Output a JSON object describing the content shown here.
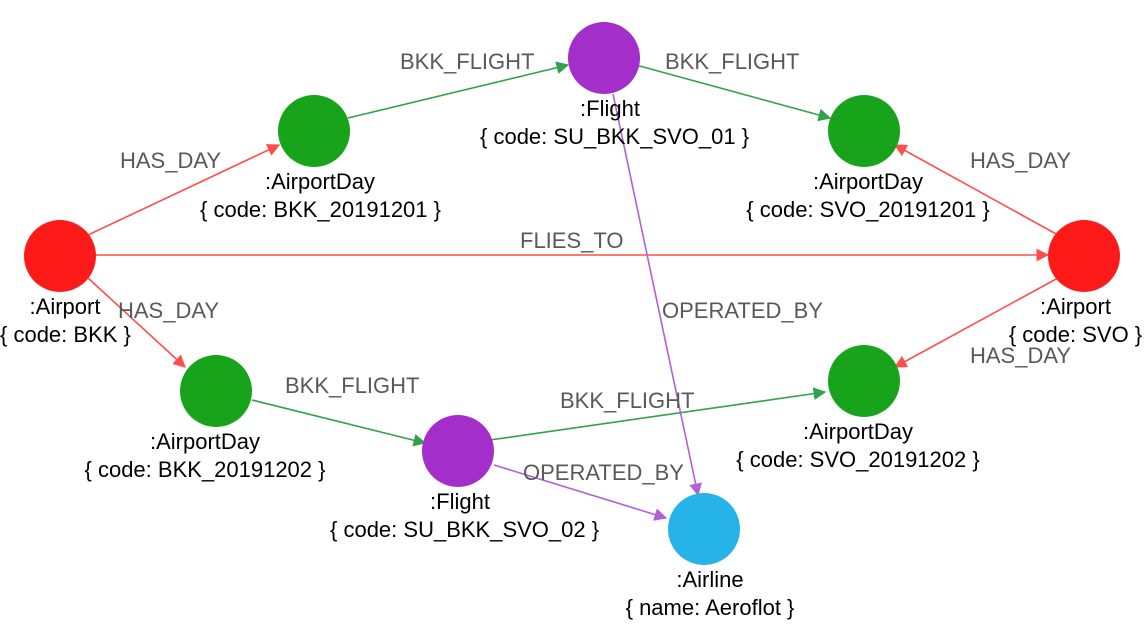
{
  "nodes": {
    "airport_bkk": {
      "type": ":Airport",
      "props": "{ code: BKK }"
    },
    "airport_svo": {
      "type": ":Airport",
      "props": "{ code: SVO }"
    },
    "airportday_bkk_1": {
      "type": ":AirportDay",
      "props": "{ code: BKK_20191201 }"
    },
    "airportday_bkk_2": {
      "type": ":AirportDay",
      "props": "{ code: BKK_20191202 }"
    },
    "airportday_svo_1": {
      "type": ":AirportDay",
      "props": "{ code: SVO_20191201 }"
    },
    "airportday_svo_2": {
      "type": ":AirportDay",
      "props": "{ code: SVO_20191202 }"
    },
    "flight_1": {
      "type": ":Flight",
      "props": "{ code: SU_BKK_SVO_01 }"
    },
    "flight_2": {
      "type": ":Flight",
      "props": "{ code: SU_BKK_SVO_02 }"
    },
    "airline": {
      "type": ":Airline",
      "props": "{ name: Aeroflot }"
    }
  },
  "edges": {
    "has_day_1": "HAS_DAY",
    "has_day_2": "HAS_DAY",
    "has_day_3": "HAS_DAY",
    "has_day_4": "HAS_DAY",
    "flies_to": "FLIES_TO",
    "bkk_flight_1": "BKK_FLIGHT",
    "bkk_flight_2": "BKK_FLIGHT",
    "bkk_flight_3": "BKK_FLIGHT",
    "bkk_flight_4": "BKK_FLIGHT",
    "operated_by_1": "OPERATED_BY",
    "operated_by_2": "OPERATED_BY"
  },
  "colors": {
    "airport": "#ff1a1a",
    "airportday": "#17a31a",
    "flight": "#a42eca",
    "airline": "#26b3e8",
    "edge_red": "#ff4d4d",
    "edge_green": "#2fa34a",
    "edge_purple": "#b45fd4"
  }
}
